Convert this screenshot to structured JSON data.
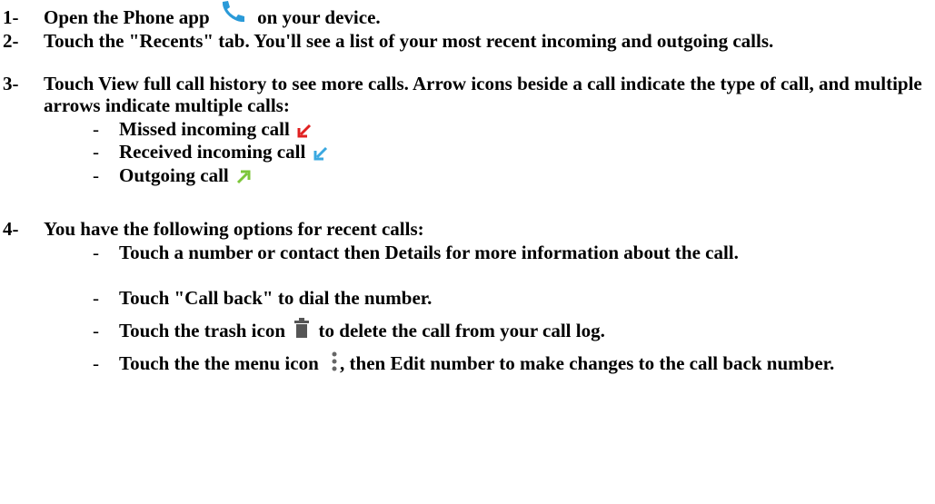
{
  "steps": [
    {
      "number": "1-",
      "text_before_icon": "Open the Phone app",
      "icon": "phone-icon",
      "text_after_icon": "on your device."
    },
    {
      "number": "2-",
      "text": "Touch the \"Recents\" tab. You'll see a list of your most recent incoming and outgoing calls."
    },
    {
      "number": "3-",
      "text": "Touch View full call history to see more calls. Arrow icons beside a call indicate the type of call, and multiple arrows indicate multiple calls:",
      "call_types": [
        {
          "dash": "-",
          "label": "Missed incoming call",
          "icon": "missed-call-arrow-icon",
          "color": "#e02020"
        },
        {
          "dash": "-",
          "label": "Received incoming call",
          "icon": "received-call-arrow-icon",
          "color": "#3aa8e0"
        },
        {
          "dash": "-",
          "label": "Outgoing call",
          "icon": "outgoing-call-arrow-icon",
          "color": "#7cc63a"
        }
      ]
    },
    {
      "number": "4-",
      "text": "You have the following options for recent calls:",
      "options": [
        {
          "dash": "-",
          "text": "Touch a number or contact then Details for more information about the call."
        },
        {
          "dash": "-",
          "text": "Touch \"Call back\" to dial the number."
        },
        {
          "dash": "-",
          "text_before_icon": "Touch the trash icon",
          "icon": "trash-icon",
          "text_after_icon": "to delete the call from your call log."
        },
        {
          "dash": "-",
          "text_before_icon": "Touch the the menu icon",
          "icon": "menu-dots-icon",
          "text_after_icon": ", then Edit number to make changes to the call back number."
        }
      ]
    }
  ],
  "colors": {
    "phone_icon": "#2a9ad8",
    "trash_icon": "#555555",
    "menu_icon": "#666666"
  }
}
